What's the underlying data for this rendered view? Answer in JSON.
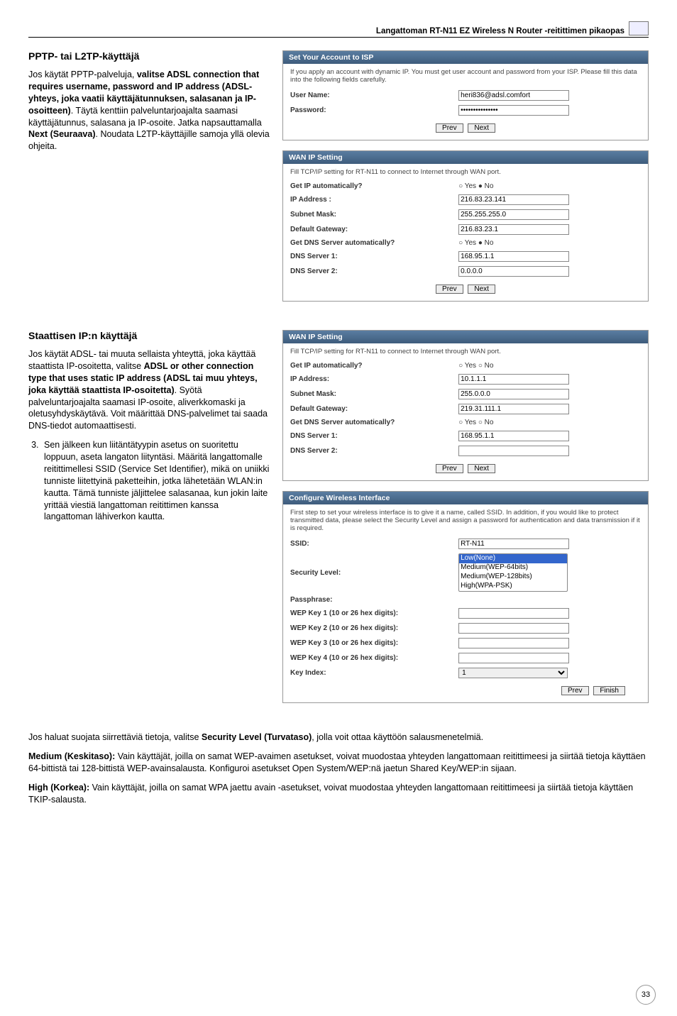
{
  "header": {
    "guide_title": "Langattoman RT-N11 EZ Wireless N Router -reitittimen pikaopas"
  },
  "section_pptp": {
    "heading": "PPTP- tai L2TP-käyttäjä",
    "para": "Jos käytät PPTP-palveluja, <b>valitse ADSL connection that requires username, password and IP address (ADSL-yhteys, joka vaatii käyttäjätunnuksen, salasanan ja IP-osoitteen)</b>. Täytä kenttiin palveluntarjoajalta saamasi käyttäjätunnus, salasana ja IP-osoite. Jatka napsauttamalla <b>Next (Seuraava)</b>. Noudata L2TP-käyttäjille samoja yllä olevia ohjeita."
  },
  "panel_isp": {
    "title": "Set Your Account to ISP",
    "desc": "If you apply an account with dynamic IP. You must get user account and password from your ISP. Please fill this data into the following fields carefully.",
    "user_label": "User Name:",
    "user_value": "heri836@adsl.comfort",
    "pass_label": "Password:",
    "pass_value": "***************",
    "prev": "Prev",
    "next": "Next"
  },
  "panel_wan1": {
    "title": "WAN IP Setting",
    "desc": "Fill TCP/IP setting for RT-N11 to connect to Internet through WAN port.",
    "rows": {
      "auto_ip_lbl": "Get IP automatically?",
      "auto_ip_val": "○ Yes   ● No",
      "ip_lbl": "IP Address :",
      "ip_val": "216.83.23.141",
      "mask_lbl": "Subnet Mask:",
      "mask_val": "255.255.255.0",
      "gw_lbl": "Default Gateway:",
      "gw_val": "216.83.23.1",
      "auto_dns_lbl": "Get DNS Server automatically?",
      "auto_dns_val": "○ Yes  ● No",
      "dns1_lbl": "DNS Server 1:",
      "dns1_val": "168.95.1.1",
      "dns2_lbl": "DNS Server 2:",
      "dns2_val": "0.0.0.0"
    },
    "prev": "Prev",
    "next": "Next"
  },
  "section_static": {
    "heading": "Staattisen IP:n käyttäjä",
    "para": "Jos käytät ADSL- tai muuta sellaista yhteyttä, joka käyttää staattista IP-osoitetta, valitse <b>ADSL or other connection type that uses static IP address (ADSL tai muu yhteys, joka käyttää staattista IP-osoitetta)</b>. Syötä palveluntarjoajalta saamasi IP-osoite, aliverkkomaski ja oletusyhdyskäytävä. Voit määrittää DNS-palvelimet tai saada DNS-tiedot automaattisesti.",
    "step3": "Sen jälkeen kun liitäntätyypin asetus on suoritettu loppuun, aseta langaton liityntäsi. Määritä langattomalle reitittimellesi SSID (Service Set Identifier), mikä on uniikki tunniste liitettyinä paketteihin, jotka lähetetään WLAN:in kautta. Tämä tunniste jäljittelee salasanaa, kun jokin laite yrittää viestiä langattoman reitittimen kanssa langattoman lähiverkon kautta."
  },
  "panel_wan2": {
    "title": "WAN IP Setting",
    "desc": "Fill TCP/IP setting for RT-N11 to connect to Internet through WAN port.",
    "rows": {
      "auto_ip_lbl": "Get IP automatically?",
      "auto_ip_val": "○ Yes ○ No",
      "ip_lbl": "IP Address:",
      "ip_val": "10.1.1.1",
      "mask_lbl": "Subnet Mask:",
      "mask_val": "255.0.0.0",
      "gw_lbl": "Default Gateway:",
      "gw_val": "219.31.111.1",
      "auto_dns_lbl": "Get DNS Server automatically?",
      "auto_dns_val": "○ Yes ○ No",
      "dns1_lbl": "DNS Server 1:",
      "dns1_val": "168.95.1.1",
      "dns2_lbl": "DNS Server 2:",
      "dns2_val": ""
    },
    "prev": "Prev",
    "next": "Next"
  },
  "panel_wifi": {
    "title": "Configure Wireless Interface",
    "desc": "First step to set your wireless interface is to give it a name, called SSID. In addition, if you would like to protect transmitted data, please select the Security Level and assign a password for authentication and data transmission if it is required.",
    "rows": {
      "ssid_lbl": "SSID:",
      "ssid_val": "RT-N11",
      "sec_lbl": "Security Level:",
      "sec_selected": "Low(None)",
      "sec_options": [
        "Low(None)",
        "Medium(WEP-64bits)",
        "Medium(WEP-128bits)",
        "High(WPA-PSK)"
      ],
      "pass_lbl": "Passphrase:",
      "k1_lbl": "WEP Key 1 (10 or 26 hex digits):",
      "k2_lbl": "WEP Key 2 (10 or 26 hex digits):",
      "k3_lbl": "WEP Key 3 (10 or 26 hex digits):",
      "k4_lbl": "WEP Key 4 (10 or 26 hex digits):",
      "ki_lbl": "Key Index:",
      "ki_val": "1"
    },
    "prev": "Prev",
    "finish": "Finish"
  },
  "bottom": {
    "p1": "Jos haluat suojata siirrettäviä tietoja, valitse <b>Security Level (Turvataso)</b>, jolla voit ottaa käyttöön salausmenetelmiä.",
    "p2": "<b>Medium (Keskitaso):</b> Vain käyttäjät, joilla on samat WEP-avaimen asetukset, voivat muodostaa yhteyden langattomaan reitittimeesi ja siirtää tietoja käyttäen 64-bittistä tai 128-bittistä WEP-avainsalausta. Konfiguroi asetukset Open System/WEP:nä jaetun Shared Key/WEP:in sijaan.",
    "p3": "<b>High (Korkea):</b> Vain käyttäjät, joilla on samat WPA jaettu avain -asetukset, voivat muodostaa yhteyden langattomaan reitittimeesi ja siirtää tietoja käyttäen TKIP-salausta."
  },
  "page_number": "33"
}
